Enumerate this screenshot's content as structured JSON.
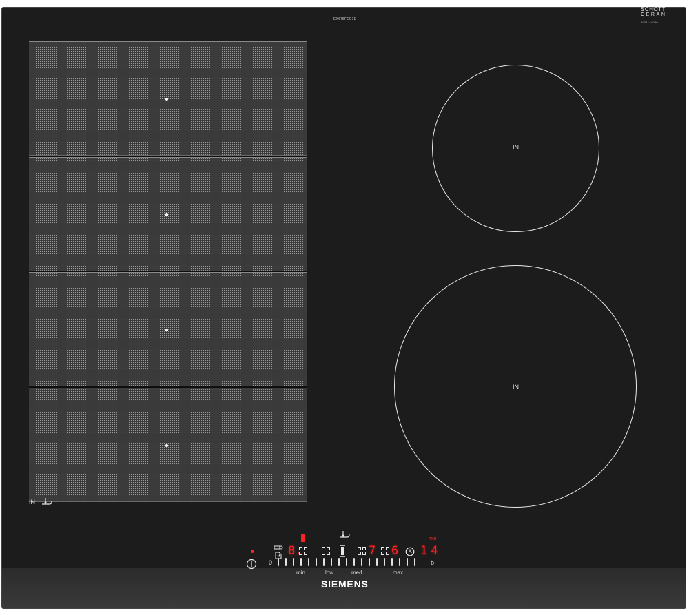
{
  "model_code": "EX675FEC1E",
  "ceran": {
    "line1": "SCHOTT",
    "line2": "CERAN",
    "serial": "9001144030"
  },
  "flex_zone": {
    "sections": 4,
    "label": "IN"
  },
  "burners": [
    {
      "id": "rear-right",
      "label": "IN"
    },
    {
      "id": "front-right",
      "label": "IN"
    }
  ],
  "controls": {
    "power_button": {
      "icon": "power-icon",
      "indicator": "on"
    },
    "zone_displays": [
      {
        "id": "flex-zone-display",
        "digit": "8.",
        "indicator": "red"
      },
      {
        "id": "zone-2",
        "digit": ""
      },
      {
        "id": "zone-3",
        "digit": "7"
      },
      {
        "id": "zone-4",
        "digit": "6"
      }
    ],
    "timer": {
      "icon": "clock-icon",
      "value": "14",
      "unit": "min"
    },
    "slider": {
      "start_label": "0",
      "end_label": "b",
      "scale": [
        "min",
        "low",
        "med",
        "max"
      ]
    }
  },
  "brand": "SIEMENS",
  "colors": {
    "glass": "#1c1c1d",
    "led": "#ff2020",
    "print": "#e9e9e9"
  }
}
